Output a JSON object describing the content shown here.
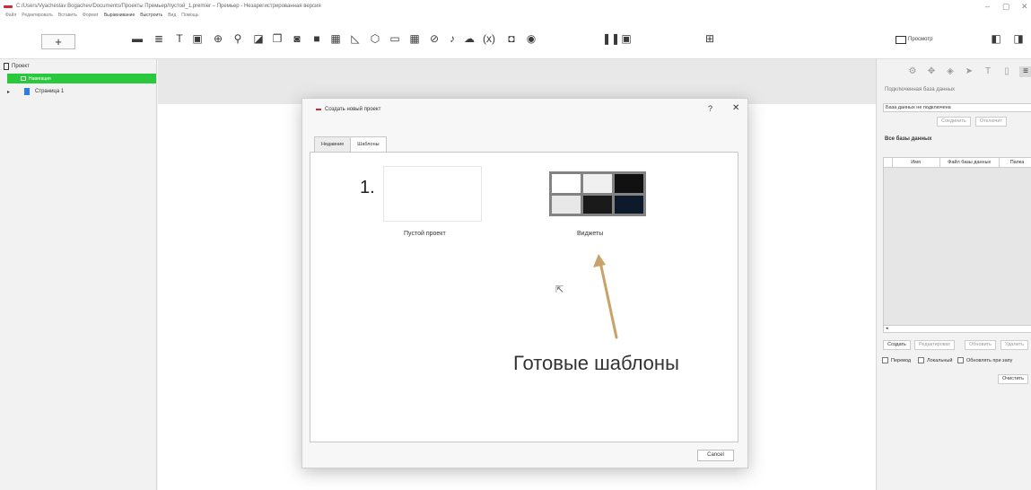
{
  "window": {
    "title": "C:/Users/Vyacheslav Bogachev/Documents/Проекты Премьер/пустой_1.premier – Премьер - Незарегистрированная версия",
    "minimize": "–",
    "maximize": "▢",
    "close": "✕"
  },
  "menu": [
    "Файл",
    "Редактировать",
    "Вставить",
    "Формат",
    "Выравнивание",
    "Выстроить",
    "Вид",
    "Помощь"
  ],
  "toolbar": {
    "add_label": "+",
    "preview_label": "Просмотр",
    "tools": [
      "image-icon",
      "list-icon",
      "text-icon",
      "pdf-icon",
      "globe-icon",
      "pin-icon",
      "edit-icon",
      "copy-icon",
      "photo-icon",
      "video-icon",
      "qr-icon",
      "chart-icon",
      "cube-icon",
      "calendar-icon",
      "table-icon",
      "check-icon",
      "mic-icon",
      "cloud-icon",
      "variable-icon",
      "slide-icon",
      "record-icon",
      "pause-icon",
      "screen-icon",
      "grid-icon"
    ]
  },
  "left_panel": {
    "header": "Проект",
    "nav_item": "Навигация",
    "page_item": "Страница 1"
  },
  "right_panel": {
    "connected_db_label": "Подключенная база данных",
    "db_status": "База данных не подключена",
    "connect_button": "Соединить",
    "disconnect_button": "Отключит",
    "all_db_label": "Все базы данных",
    "columns": [
      "Имя",
      "Файл базы данных",
      "Папка"
    ],
    "scroll_left": "◂",
    "create_button": "Создать",
    "edit_button": "Редактироват",
    "refresh_button": "Обновить",
    "delete_button": "Удалить",
    "checkboxes": [
      "Перевод",
      "Локальный",
      "Обновлять при запу"
    ],
    "clear_button": "Очистить"
  },
  "dialog": {
    "title": "Создать новый проект",
    "help": "?",
    "close": "✕",
    "tabs": [
      "Недавние",
      "Шаблоны"
    ],
    "active_tab": 1,
    "templates": [
      {
        "label": "Пустой проект"
      },
      {
        "label": "Виджеты"
      }
    ],
    "cancel_button": "Cancel"
  },
  "annotations": {
    "number": "1.",
    "caption": "Готовые шаблоны"
  },
  "colors": {
    "accent_green": "#2ac83c",
    "brand_red": "#d2263a",
    "arrow": "#c9a16a"
  }
}
